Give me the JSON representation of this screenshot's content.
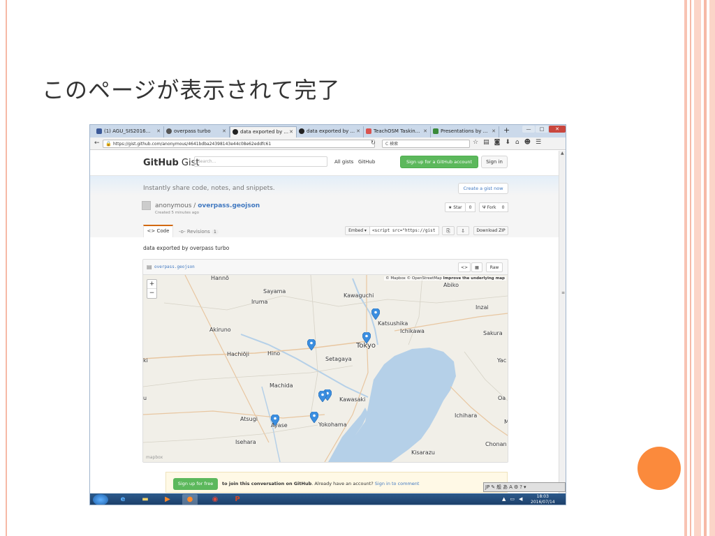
{
  "slide": {
    "title": "このページが表示されて完了"
  },
  "colors": {
    "accent_orange": "#fb8a3c",
    "slide_stripe": "#f6b9a6",
    "github_green": "#5cb85c",
    "link_blue": "#4078c0",
    "pin_blue": "#3b8ee0",
    "water": "#b5d0e8"
  },
  "browser": {
    "tabs": [
      {
        "label": "(1) AGU_SIS2016...",
        "icon": "facebook-icon",
        "active": false
      },
      {
        "label": "overpass turbo",
        "icon": "overpass-icon",
        "active": false
      },
      {
        "label": "data exported by ...",
        "icon": "github-icon",
        "active": true
      },
      {
        "label": "data exported by ...",
        "icon": "github-icon",
        "active": false
      },
      {
        "label": "TeachOSM Taskin...",
        "icon": "teachosm-icon",
        "active": false
      },
      {
        "label": "Presentations by ...",
        "icon": "slides-icon",
        "active": false
      }
    ],
    "new_tab": "+",
    "url": "https://gist.github.com/anonymous/4641bdba24398143e44c08e62eddfc61",
    "search_placeholder": "C 検索",
    "window_buttons": [
      "—",
      "□",
      "✕"
    ]
  },
  "gist": {
    "logo_bold": "GitHub",
    "logo_light": " Gist",
    "search_placeholder": "Search...",
    "nav_all_gists": "All gists",
    "nav_github": "GitHub",
    "signup_button": "Sign up for a GitHub account",
    "signin_button": "Sign in",
    "tagline": "Instantly share code, notes, and snippets.",
    "create_button": "Create a gist now",
    "owner": "anonymous",
    "separator": " / ",
    "filename_title": "overpass.geojson",
    "created": "Created 5 minutes ago",
    "star_label": "★ Star",
    "star_count": "0",
    "fork_label": "Ψ Fork",
    "fork_count": "0",
    "tab_code": "<> Code",
    "tab_revisions": "-o- Revisions",
    "revisions_count": "1",
    "embed_label": "Embed ▾",
    "embed_value": "<script src=\"https://gist",
    "download_zip": "Download ZIP",
    "description": "data exported by overpass turbo",
    "file_name": "overpass.geojson",
    "raw_button": "Raw",
    "code_toggle": "<>",
    "comment_signup": "Sign up for free",
    "comment_text_bold": "to join this conversation on GitHub",
    "comment_text_rest": ". Already have an account? ",
    "comment_signin_link": "Sign in to comment"
  },
  "map": {
    "attribution_1": "© Mapbox © OpenStreetMap ",
    "attribution_2": "Improve the underlying map",
    "zoom_in": "+",
    "zoom_out": "−",
    "mapbox_logo": "mapbox",
    "places": [
      {
        "name": "Hannō"
      },
      {
        "name": "Sayama"
      },
      {
        "name": "Iruma"
      },
      {
        "name": "Kawaguchi"
      },
      {
        "name": "Abiko"
      },
      {
        "name": "Inzai"
      },
      {
        "name": "Katsushika"
      },
      {
        "name": "Ichikawa"
      },
      {
        "name": "Akiruno"
      },
      {
        "name": "Tokyo"
      },
      {
        "name": "Sakura"
      },
      {
        "name": "Hachiōji"
      },
      {
        "name": "Hino"
      },
      {
        "name": "Setagaya"
      },
      {
        "name": "ki"
      },
      {
        "name": "Yac"
      },
      {
        "name": "Machida"
      },
      {
        "name": "Kawasaki"
      },
      {
        "name": "u"
      },
      {
        "name": "Oa"
      },
      {
        "name": "Atsugi"
      },
      {
        "name": "Ayase"
      },
      {
        "name": "Yokohama"
      },
      {
        "name": "Ichihara"
      },
      {
        "name": "M"
      },
      {
        "name": "Isehara"
      },
      {
        "name": "Chonan"
      },
      {
        "name": "Kisarazu"
      }
    ],
    "marker_count": 7
  },
  "taskbar": {
    "items": [
      "start-orb-icon",
      "ie-icon",
      "explorer-icon",
      "media-player-icon",
      "firefox-icon",
      "chrome-icon",
      "powerpoint-icon"
    ],
    "ime": [
      "JP",
      "✎",
      "般",
      "あ",
      "A",
      "⚙",
      "?",
      "▾"
    ],
    "time": "18:03",
    "date": "2016/07/14"
  }
}
